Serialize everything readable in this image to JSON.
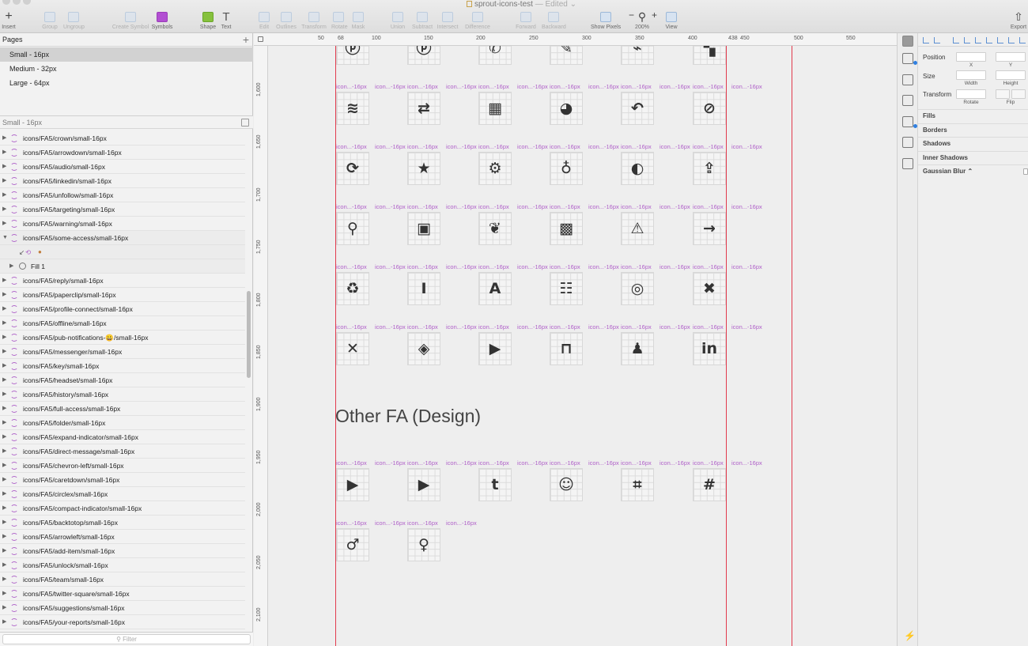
{
  "window": {
    "doc_title": "sprout-icons-test",
    "doc_status": "— Edited ⌄"
  },
  "toolbar": {
    "items": [
      {
        "key": "insert",
        "label": "Insert",
        "icon": "plus-icon",
        "enabled": true
      },
      {
        "key": "group",
        "label": "Group",
        "icon": "group-icon",
        "enabled": false
      },
      {
        "key": "ungroup",
        "label": "Ungroup",
        "icon": "ungroup-icon",
        "enabled": false
      },
      {
        "key": "create_symbol",
        "label": "Create Symbol",
        "icon": "create-symbol-icon",
        "enabled": false
      },
      {
        "key": "symbols",
        "label": "Symbols",
        "icon": "symbols-icon",
        "enabled": true
      },
      {
        "key": "shape",
        "label": "Shape",
        "icon": "shape-icon",
        "enabled": true
      },
      {
        "key": "text",
        "label": "Text",
        "icon": "text-icon",
        "enabled": true
      },
      {
        "key": "edit",
        "label": "Edit",
        "icon": "edit-icon",
        "enabled": false
      },
      {
        "key": "outlines",
        "label": "Outlines",
        "icon": "outlines-icon",
        "enabled": false
      },
      {
        "key": "transform",
        "label": "Transform",
        "icon": "transform-icon",
        "enabled": false
      },
      {
        "key": "rotate",
        "label": "Rotate",
        "icon": "rotate-icon",
        "enabled": false
      },
      {
        "key": "mask",
        "label": "Mask",
        "icon": "mask-icon",
        "enabled": false
      },
      {
        "key": "union",
        "label": "Union",
        "icon": "union-icon",
        "enabled": false
      },
      {
        "key": "subtract",
        "label": "Subtract",
        "icon": "subtract-icon",
        "enabled": false
      },
      {
        "key": "intersect",
        "label": "Intersect",
        "icon": "intersect-icon",
        "enabled": false
      },
      {
        "key": "difference",
        "label": "Difference",
        "icon": "difference-icon",
        "enabled": false
      },
      {
        "key": "forward",
        "label": "Forward",
        "icon": "forward-icon",
        "enabled": false
      },
      {
        "key": "backward",
        "label": "Backward",
        "icon": "backward-icon",
        "enabled": false
      },
      {
        "key": "show_pixels",
        "label": "Show Pixels",
        "icon": "show-pixels-icon",
        "enabled": true
      },
      {
        "key": "zoom",
        "label": "200%",
        "icon": "zoom-icon",
        "enabled": true
      },
      {
        "key": "view",
        "label": "View",
        "icon": "view-icon",
        "enabled": true
      },
      {
        "key": "export",
        "label": "Export",
        "icon": "export-icon",
        "enabled": true
      }
    ],
    "zoom_minus": "−",
    "zoom_plus": "+"
  },
  "pages": {
    "header": "Pages",
    "add": "+",
    "items": [
      "Small - 16px",
      "Medium - 32px",
      "Large - 64px"
    ],
    "selected": 0
  },
  "layers": {
    "header": "Small - 16px",
    "filter_placeholder": "Filter",
    "items": [
      {
        "name": "icons/FA5/crown/small-16px"
      },
      {
        "name": "icons/FA5/arrowdown/small-16px"
      },
      {
        "name": "icons/FA5/audio/small-16px"
      },
      {
        "name": "icons/FA5/linkedin/small-16px"
      },
      {
        "name": "icons/FA5/unfollow/small-16px"
      },
      {
        "name": "icons/FA5/targeting/small-16px"
      },
      {
        "name": "icons/FA5/warning/small-16px"
      },
      {
        "name": "icons/FA5/some-access/small-16px",
        "open": true
      },
      {
        "name": "",
        "type": "override-row"
      },
      {
        "name": "Fill 1",
        "type": "fill-row"
      },
      {
        "name": "icons/FA5/reply/small-16px"
      },
      {
        "name": "icons/FA5/paperclip/small-16px"
      },
      {
        "name": "icons/FA5/profile-connect/small-16px"
      },
      {
        "name": "icons/FA5/offline/small-16px"
      },
      {
        "name": "icons/FA5/pub-notifications-😀/small-16px"
      },
      {
        "name": "icons/FA5/messenger/small-16px"
      },
      {
        "name": "icons/FA5/key/small-16px"
      },
      {
        "name": "icons/FA5/headset/small-16px"
      },
      {
        "name": "icons/FA5/history/small-16px"
      },
      {
        "name": "icons/FA5/full-access/small-16px"
      },
      {
        "name": "icons/FA5/folder/small-16px"
      },
      {
        "name": "icons/FA5/expand-indicator/small-16px"
      },
      {
        "name": "icons/FA5/direct-message/small-16px"
      },
      {
        "name": "icons/FA5/chevron-left/small-16px"
      },
      {
        "name": "icons/FA5/caretdown/small-16px"
      },
      {
        "name": "icons/FA5/circlex/small-16px"
      },
      {
        "name": "icons/FA5/compact-indicator/small-16px"
      },
      {
        "name": "icons/FA5/backtotop/small-16px"
      },
      {
        "name": "icons/FA5/arrowleft/small-16px"
      },
      {
        "name": "icons/FA5/add-item/small-16px"
      },
      {
        "name": "icons/FA5/unlock/small-16px"
      },
      {
        "name": "icons/FA5/team/small-16px"
      },
      {
        "name": "icons/FA5/twitter-square/small-16px"
      },
      {
        "name": "icons/FA5/suggestions/small-16px"
      },
      {
        "name": "icons/FA5/your-reports/small-16px"
      }
    ]
  },
  "rulers": {
    "top_labels": [
      "50",
      "68",
      "100",
      "150",
      "200",
      "250",
      "300",
      "350",
      "400",
      "438",
      "450",
      "500",
      "550"
    ],
    "left_labels": [
      "1,600",
      "1,650",
      "1,700",
      "1,750",
      "1,800",
      "1,850",
      "1,900",
      "1,950",
      "2,000",
      "2,050",
      "2,100"
    ]
  },
  "canvas": {
    "artboard_label": "icon...-16px",
    "top_row_glyphs": [
      "ⓟ",
      "ⓟ",
      "✆",
      "✎",
      "⌁",
      "▚"
    ],
    "rows": [
      {
        "glyphs": [
          "≋",
          "⇄",
          "▦",
          "◕",
          "↶",
          "⊘"
        ],
        "icons": [
          "rss-icon",
          "retweet-icon",
          "dashboard-icon",
          "pie-chart-icon",
          "reply-icon",
          "ban-icon"
        ]
      },
      {
        "glyphs": [
          "⟳",
          "★",
          "⚙",
          "♁",
          "◐",
          "⇪"
        ],
        "icons": [
          "refresh-icon",
          "star-icon",
          "gear-icon",
          "lightbulb-icon",
          "contrast-icon",
          "upload-icon"
        ]
      },
      {
        "glyphs": [
          "⚲",
          "▣",
          "❦",
          "▩",
          "⚠",
          "→"
        ],
        "icons": [
          "search-icon",
          "save-icon",
          "twitter-icon",
          "twitter-square-icon",
          "warning-icon",
          "arrow-right-icon"
        ]
      },
      {
        "glyphs": [
          "♻",
          "I",
          "A",
          "☷",
          "◎",
          "✖"
        ],
        "icons": [
          "trash-icon",
          "text-cursor-icon",
          "font-icon",
          "team-icon",
          "target-icon",
          "close-bold-icon"
        ]
      },
      {
        "glyphs": [
          "✕",
          "◈",
          "▶",
          "⊓",
          "♟",
          "in"
        ],
        "icons": [
          "close-icon",
          "diamond-icon",
          "video-icon",
          "unlock-icon",
          "user-remove-icon",
          "linkedin-icon"
        ]
      }
    ],
    "section_title": "Other FA (Design)",
    "other_rows": [
      {
        "glyphs": [
          "▶",
          "▶",
          "t",
          "☺",
          "⌗",
          "#"
        ],
        "icons": [
          "youtube-square-icon",
          "youtube-icon",
          "tumblr-icon",
          "reddit-icon",
          "slack-icon",
          "slack-hash-icon"
        ]
      },
      {
        "glyphs": [
          "♂",
          "♀"
        ],
        "icons": [
          "male-icon",
          "female-icon"
        ]
      }
    ]
  },
  "inspector": {
    "position_label": "Position",
    "size_label": "Size",
    "transform_label": "Transform",
    "x_label": "X",
    "y_label": "Y",
    "width_label": "Width",
    "height_label": "Height",
    "rotate_label": "Rotate",
    "flip_label": "Flip",
    "sections": [
      "Fills",
      "Borders",
      "Shadows",
      "Inner Shadows",
      "Gaussian Blur ⌃"
    ]
  },
  "colors": {
    "guide": "#e23a4d",
    "artboard_label": "#b061c9",
    "selection_accent": "#2f7fe0"
  }
}
